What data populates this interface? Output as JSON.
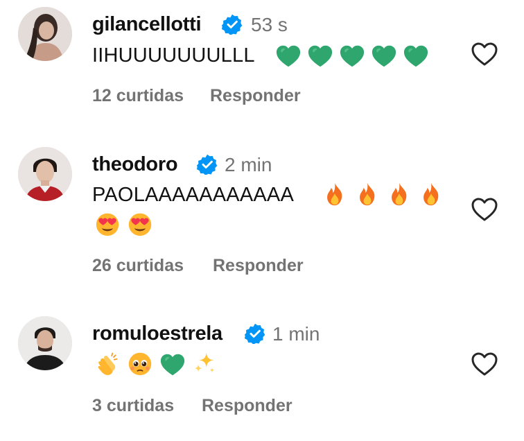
{
  "comments": [
    {
      "username": "gilancellotti",
      "time": "53 s",
      "text": "IIHUUUUUUULLL",
      "emojis": [
        "green-heart",
        "green-heart",
        "green-heart",
        "green-heart",
        "green-heart"
      ],
      "likes": "12 curtidas",
      "reply": "Responder"
    },
    {
      "username": "theodoro",
      "time": "2 min",
      "text": "PAOLAAAAAAAAAAA",
      "emojis": [
        "fire",
        "fire",
        "fire",
        "fire",
        "heart-eyes",
        "heart-eyes"
      ],
      "likes": "26 curtidas",
      "reply": "Responder"
    },
    {
      "username": "romuloestrela",
      "time": "1 min",
      "text": "",
      "emojis": [
        "clapping-hands",
        "pleading-face",
        "green-heart",
        "sparkles"
      ],
      "likes": "3 curtidas",
      "reply": "Responder"
    }
  ],
  "colors": {
    "verified": "#0095f6",
    "muted": "#737373",
    "green_heart": "#2ea66d",
    "fire": "#f4701f"
  }
}
